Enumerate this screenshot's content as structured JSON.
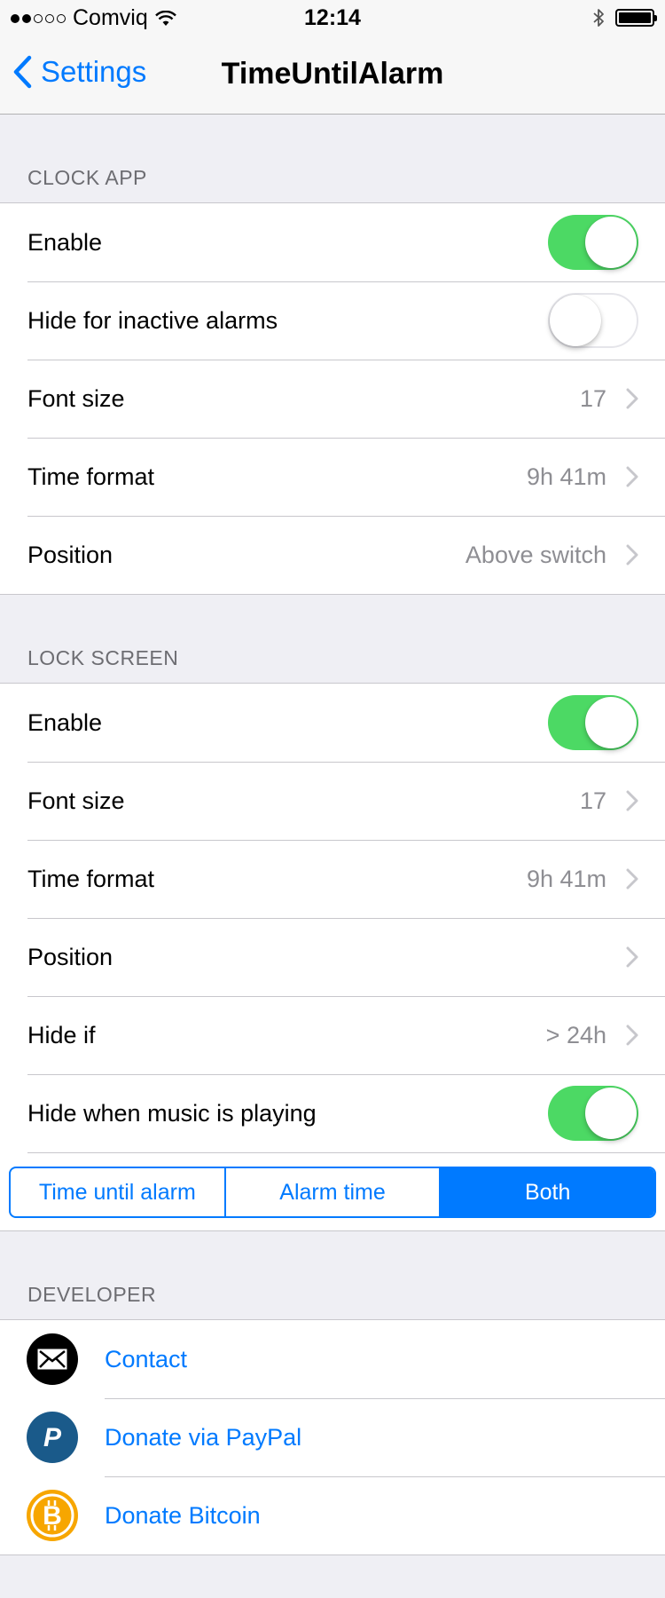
{
  "status_bar": {
    "carrier": "Comviq",
    "time": "12:14"
  },
  "nav": {
    "back_label": "Settings",
    "title": "TimeUntilAlarm"
  },
  "clock_app": {
    "header": "CLOCK APP",
    "rows": [
      {
        "label": "Enable",
        "toggle": true
      },
      {
        "label": "Hide for inactive alarms",
        "toggle": false
      },
      {
        "label": "Font size",
        "value": "17"
      },
      {
        "label": "Time format",
        "value": "9h 41m"
      },
      {
        "label": "Position",
        "value": "Above switch"
      }
    ]
  },
  "lock_screen": {
    "header": "LOCK SCREEN",
    "rows": [
      {
        "label": "Enable",
        "toggle": true
      },
      {
        "label": "Font size",
        "value": "17"
      },
      {
        "label": "Time format",
        "value": "9h 41m"
      },
      {
        "label": "Position",
        "value": ""
      },
      {
        "label": "Hide if",
        "value": "> 24h"
      },
      {
        "label": "Hide when music is playing",
        "toggle": true
      }
    ],
    "segmented": {
      "options": [
        "Time until alarm",
        "Alarm time",
        "Both"
      ],
      "selected": "Both"
    }
  },
  "developer": {
    "header": "DEVELOPER",
    "rows": [
      {
        "label": "Contact",
        "icon": "envelope-icon"
      },
      {
        "label": "Donate via PayPal",
        "icon": "paypal-icon"
      },
      {
        "label": "Donate Bitcoin",
        "icon": "bitcoin-icon"
      }
    ]
  },
  "colors": {
    "accent": "#007aff",
    "toggle_on": "#4cd964",
    "background": "#efeff4",
    "paypal": "#1a5a8a",
    "bitcoin": "#f7a600"
  }
}
